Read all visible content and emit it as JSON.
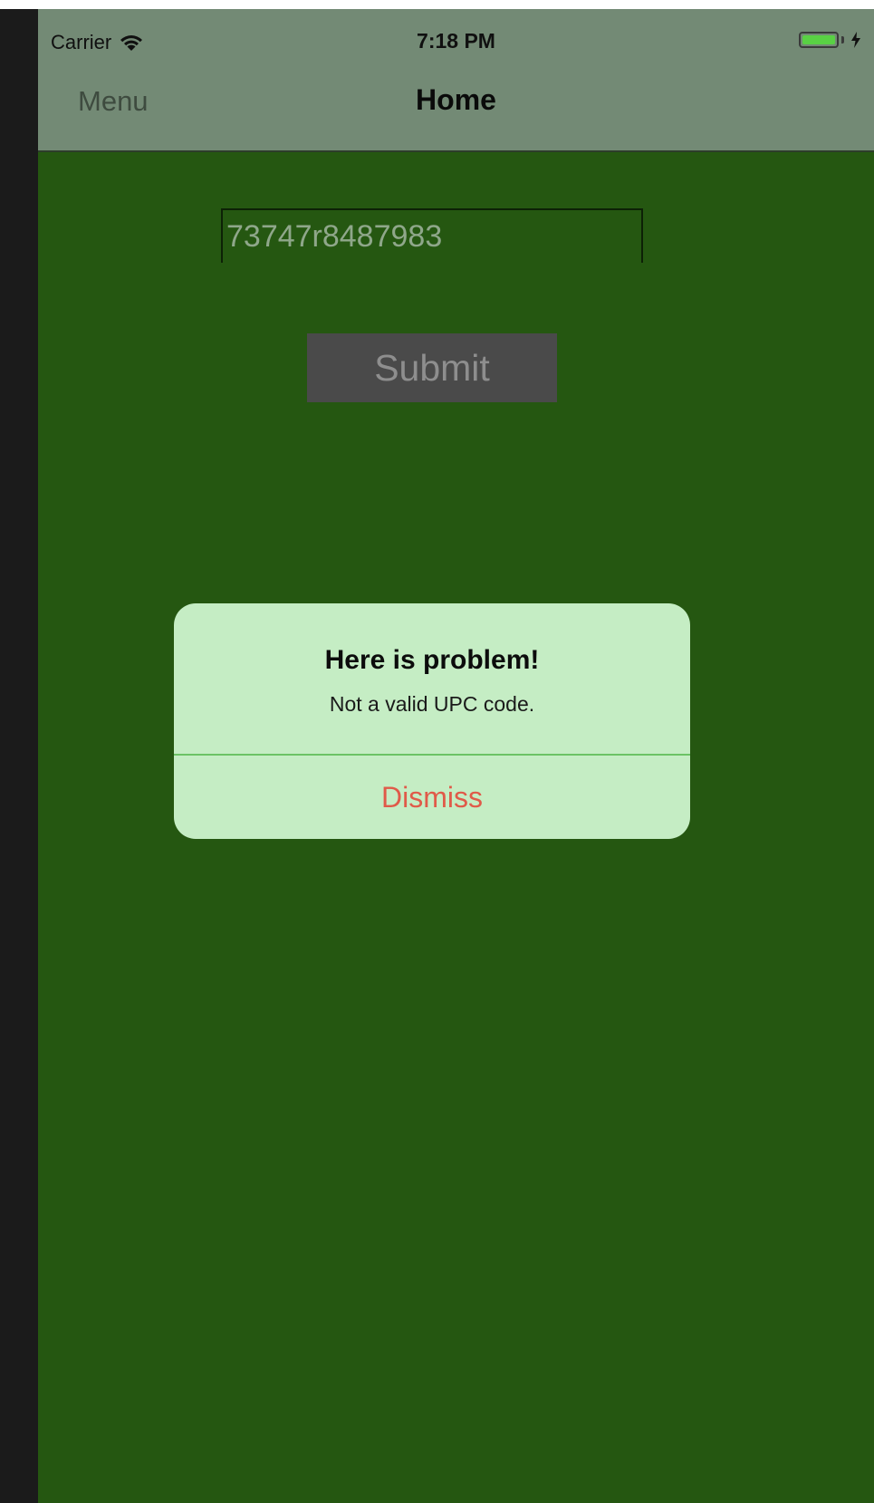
{
  "status_bar": {
    "carrier": "Carrier",
    "time": "7:18 PM",
    "battery_level": 1.0,
    "charging": true,
    "wifi_icon": "wifi-icon",
    "battery_color": "#59d144"
  },
  "nav_bar": {
    "left_label": "Menu",
    "title": "Home",
    "background_color": "#738a75"
  },
  "form": {
    "upc_value": "73747r8487983",
    "submit_label": "Submit"
  },
  "alert": {
    "title": "Here is problem!",
    "message": "Not a valid UPC code.",
    "dismiss_label": "Dismiss",
    "dismiss_color": "#e05a49",
    "background_color": "#c5edc4"
  },
  "colors": {
    "screen_background": "#255711",
    "button_background": "#4a4a4a"
  }
}
